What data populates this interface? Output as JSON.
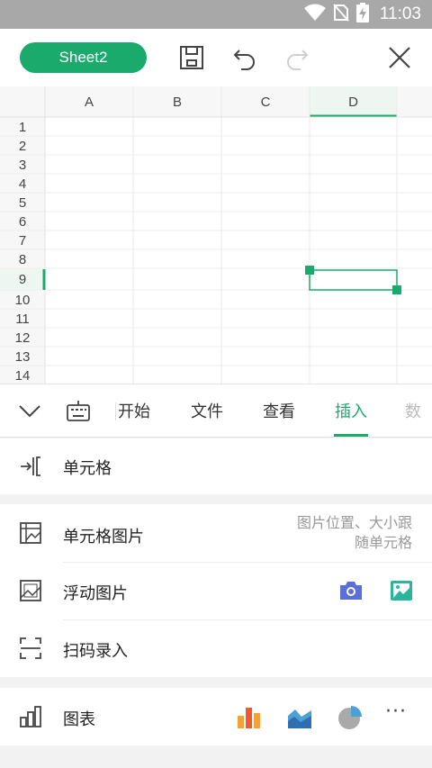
{
  "status_bar": {
    "time": "11:03"
  },
  "toolbar": {
    "sheet_name": "Sheet2"
  },
  "grid": {
    "columns": [
      "A",
      "B",
      "C",
      "D"
    ],
    "rows": [
      "1",
      "2",
      "3",
      "4",
      "5",
      "6",
      "7",
      "8",
      "9",
      "10",
      "11",
      "12",
      "13",
      "14"
    ],
    "selected_row": "9",
    "selected_column": "D"
  },
  "tabs": [
    {
      "label": "开始"
    },
    {
      "label": "文件"
    },
    {
      "label": "查看"
    },
    {
      "label": "插入"
    },
    {
      "label": "数"
    }
  ],
  "active_tab": "插入",
  "insert_panel": {
    "cell": {
      "label": "单元格"
    },
    "cell_image": {
      "label": "单元格图片",
      "hint_line1": "图片位置、大小跟",
      "hint_line2": "随单元格"
    },
    "float_image": {
      "label": "浮动图片"
    },
    "scan_entry": {
      "label": "扫码录入"
    },
    "chart": {
      "label": "图表",
      "more": "···"
    }
  },
  "colors": {
    "accent": "#1aaa6b",
    "camera": "#5b6fd6",
    "gallery": "#2bb59a"
  },
  "icons": [
    "wifi-icon",
    "sim-icon",
    "battery-icon",
    "save-icon",
    "undo-icon",
    "redo-icon",
    "close-icon",
    "collapse-icon",
    "keyboard-icon",
    "cell-insert-icon",
    "cell-image-icon",
    "float-image-icon",
    "camera-icon",
    "gallery-icon",
    "scan-icon",
    "chart-icon",
    "bar-chart-icon",
    "area-chart-icon",
    "pie-chart-icon"
  ]
}
